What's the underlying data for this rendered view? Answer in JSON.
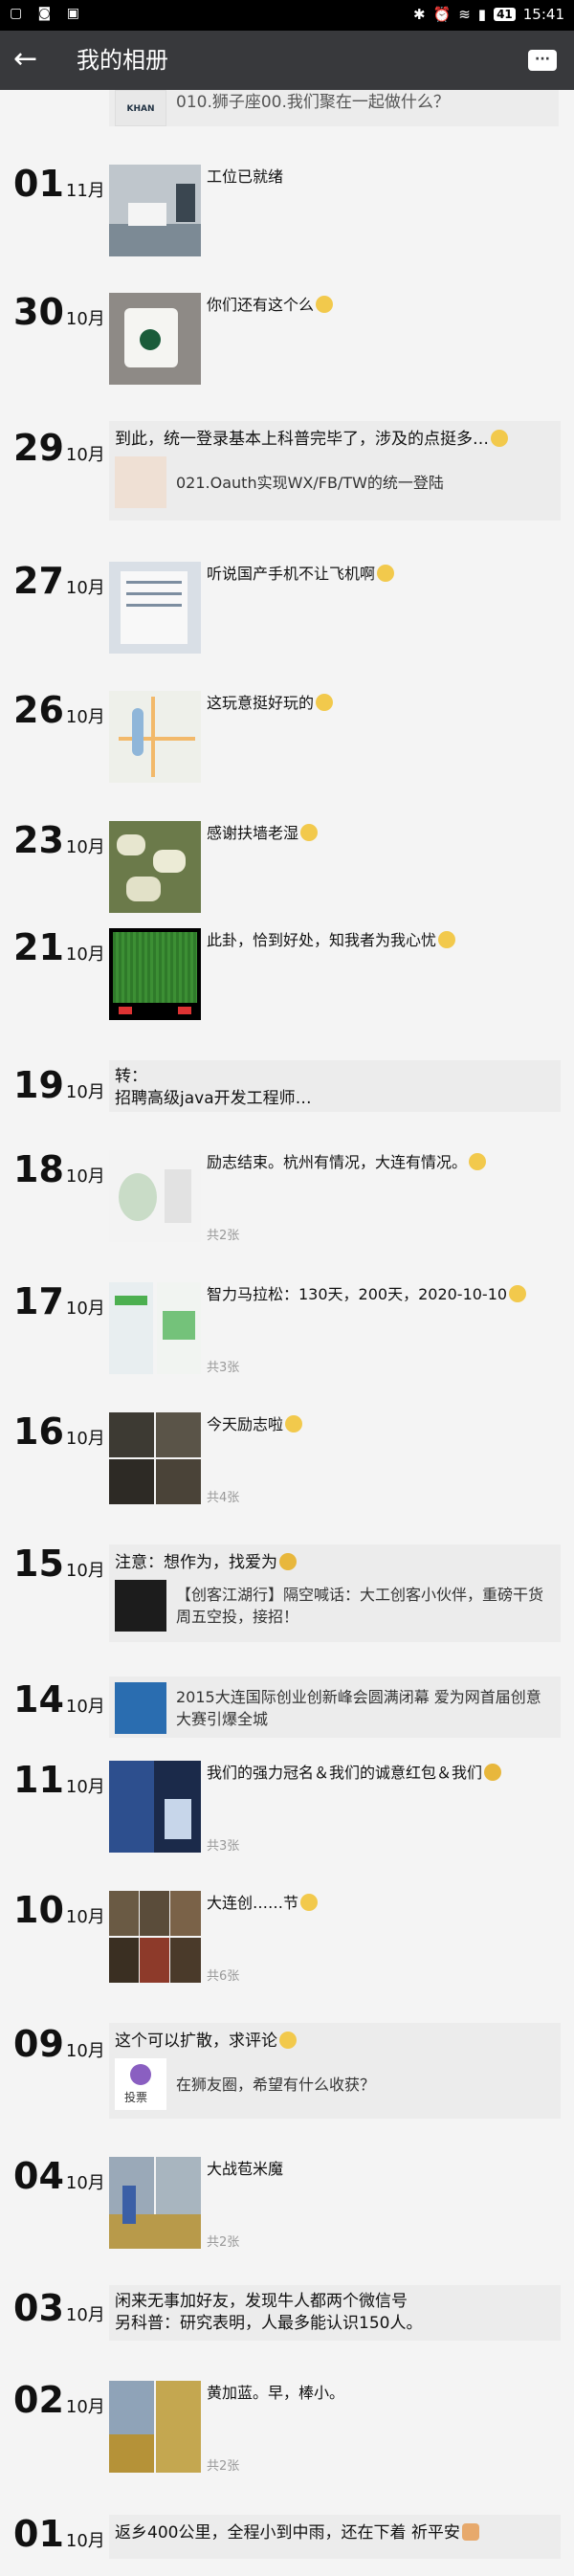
{
  "status_bar": {
    "time": "15:41",
    "battery": "41"
  },
  "app_bar": {
    "title": "我的相册"
  },
  "top_partial": {
    "thumb_text": "KHAN",
    "text": "010.狮子座00.我们聚在一起做什么？"
  },
  "entries": [
    {
      "day": "01",
      "month": "11月",
      "caption": "工位已就绪",
      "count": ""
    },
    {
      "day": "30",
      "month": "10月",
      "caption": "你们还有这个么",
      "count": ""
    },
    {
      "day": "29",
      "month": "10月",
      "caption": "到此，统一登录基本上科普完毕了，涉及的点挺多…",
      "sub": "021.Oauth实现WX/FB/TW的统一登陆"
    },
    {
      "day": "27",
      "month": "10月",
      "caption": "听说国产手机不让飞机啊",
      "count": ""
    },
    {
      "day": "26",
      "month": "10月",
      "caption": "这玩意挺好玩的",
      "count": ""
    },
    {
      "day": "23",
      "month": "10月",
      "caption": "感谢扶墙老湿",
      "count": ""
    },
    {
      "day": "21",
      "month": "10月",
      "caption": "此卦，恰到好处，知我者为我心忧",
      "count": ""
    },
    {
      "day": "19",
      "month": "10月",
      "caption": "转：\n招聘高级java开发工程师…"
    },
    {
      "day": "18",
      "month": "10月",
      "caption": "励志结束。杭州有情况，大连有情况。",
      "count": "共2张"
    },
    {
      "day": "17",
      "month": "10月",
      "caption": "智力马拉松：130天，200天，2020-10-10",
      "count": "共3张"
    },
    {
      "day": "16",
      "month": "10月",
      "caption": "今天励志啦",
      "count": "共4张"
    },
    {
      "day": "15",
      "month": "10月",
      "caption": "注意：想作为，找爱为",
      "sub": "【创客江湖行】隔空喊话：大工创客小伙伴，重磅干货周五空投，接招！"
    },
    {
      "day": "14",
      "month": "10月",
      "caption": "2015大连国际创业创新峰会圆满闭幕 爱为网首届创意大赛引爆全城"
    },
    {
      "day": "11",
      "month": "10月",
      "caption": "我们的强力冠名＆我们的诚意红包＆我们",
      "count": "共3张"
    },
    {
      "day": "10",
      "month": "10月",
      "caption": "大连创……节",
      "count": "共6张"
    },
    {
      "day": "09",
      "month": "10月",
      "caption": "这个可以扩散，求评论",
      "sub": "在狮友圈，希望有什么收获？",
      "sub_thumb": "投票"
    },
    {
      "day": "04",
      "month": "10月",
      "caption": "大战苞米魔",
      "count": "共2张"
    },
    {
      "day": "03",
      "month": "10月",
      "caption": "闲来无事加好友，发现牛人都两个微信号\n另科普：研究表明，人最多能认识150人。"
    },
    {
      "day": "02",
      "month": "10月",
      "caption": "黄加蓝。早，棒小。",
      "count": "共2张"
    },
    {
      "day": "01",
      "month": "10月",
      "caption": "返乡400公里，全程小到中雨，还在下着 祈平安"
    }
  ]
}
